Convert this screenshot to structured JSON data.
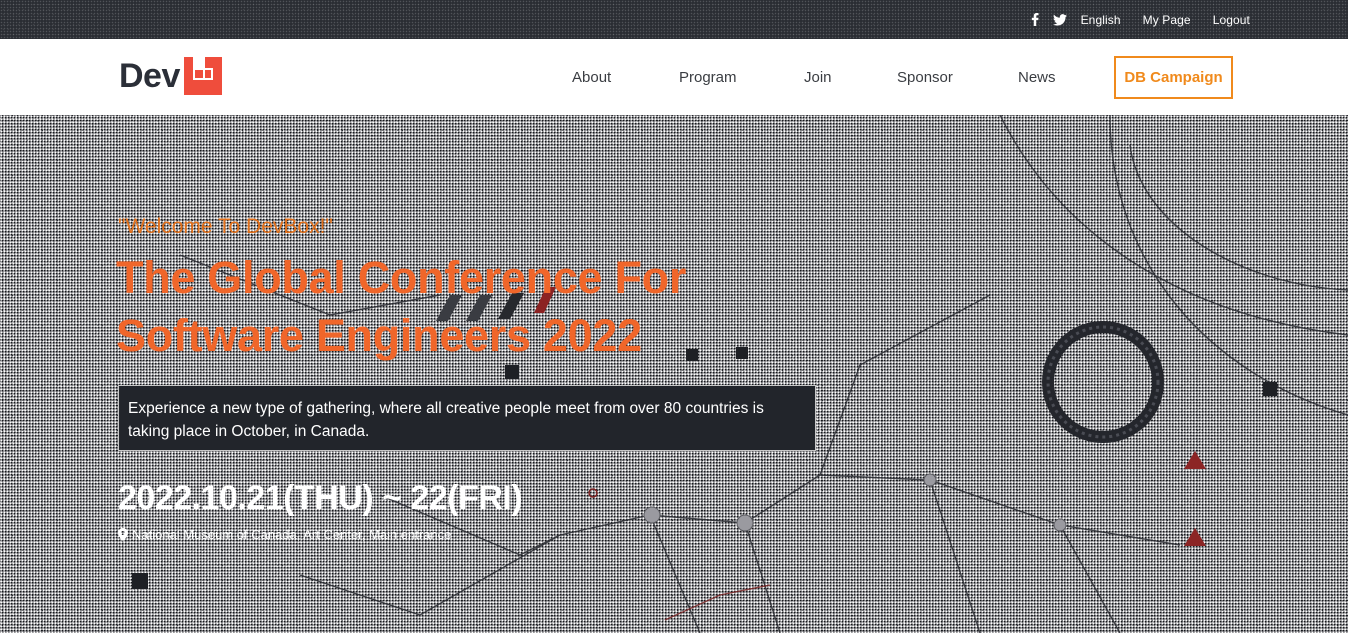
{
  "topbar": {
    "social": [
      {
        "icon": "facebook-icon"
      },
      {
        "icon": "twitter-icon"
      }
    ],
    "links": {
      "language": "English",
      "my_page": "My Page",
      "logout": "Logout"
    }
  },
  "header": {
    "logo_text": "Dev",
    "nav": {
      "about": "About",
      "program": "Program",
      "join": "Join",
      "sponsor": "Sponsor",
      "news": "News"
    },
    "cta": "DB Campaign"
  },
  "hero": {
    "welcome": "\"Welcome To DevBox!\"",
    "headline_line1": "The Global Conference For",
    "headline_line2": "Software Engineers 2022",
    "description": "Experience a new type of gathering, where all creative people meet from over 80 countries is taking place in October, in Canada.",
    "dates": "2022.10.21(THU) ~ 22(FRI)",
    "venue": "National Museum of Canada, Art Center, Main entrance"
  },
  "colors": {
    "accent_orange": "#f08a1c",
    "headline_orange": "#f0662a",
    "logo_red": "#ef4d3c",
    "topbar_dark": "#2a2d33",
    "text_dark": "#2b2f38"
  }
}
